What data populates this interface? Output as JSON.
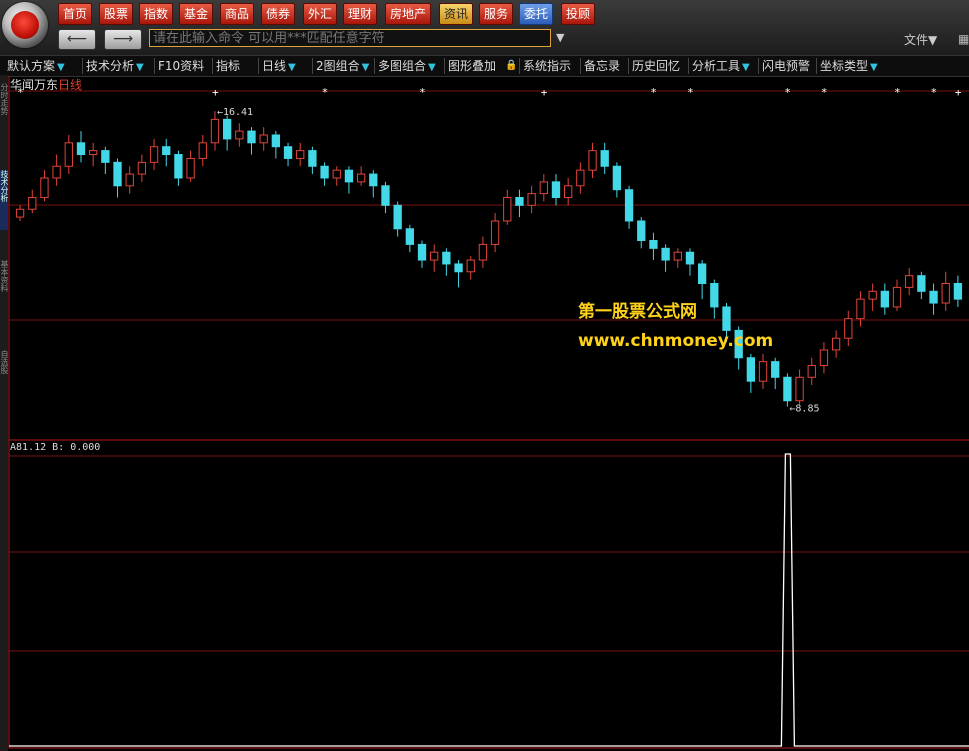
{
  "top_nav": {
    "items": [
      {
        "label": "首页"
      },
      {
        "label": "股票"
      },
      {
        "label": "指数"
      },
      {
        "label": "基金"
      },
      {
        "label": "商品"
      },
      {
        "label": "债券"
      },
      {
        "label": "外汇"
      },
      {
        "label": "理财"
      },
      {
        "label": "房地产"
      },
      {
        "label": "资讯"
      },
      {
        "label": "服务"
      },
      {
        "label": "委托"
      },
      {
        "label": "投顾"
      }
    ],
    "active": "委托",
    "highlight": "资讯"
  },
  "command": {
    "placeholder": "请在此输入命令    可以用***匹配任意字符",
    "back_icon": "back-arrow-icon",
    "forward_icon": "forward-arrow-icon"
  },
  "file_menu": {
    "label": "文件▼"
  },
  "toolbar": {
    "items": [
      {
        "label": "默认方案",
        "dropdown": true
      },
      {
        "label": "技术分析",
        "dropdown": true
      },
      {
        "label": "F10资料",
        "dropdown": false
      },
      {
        "label": "指标",
        "dropdown": false
      },
      {
        "label": "日线",
        "dropdown": true
      },
      {
        "label": "2图组合",
        "dropdown": true
      },
      {
        "label": "多图组合",
        "dropdown": true
      },
      {
        "label": "图形叠加",
        "dropdown": false
      },
      {
        "label": "系统指示",
        "dropdown": false
      },
      {
        "label": "备忘录",
        "dropdown": false
      },
      {
        "label": "历史回忆",
        "dropdown": false
      },
      {
        "label": "分析工具",
        "dropdown": true
      },
      {
        "label": "闪电预警",
        "dropdown": false
      },
      {
        "label": "坐标类型",
        "dropdown": true
      }
    ]
  },
  "left_tabs": [
    "分时走势",
    "技术分析",
    "基本资料",
    "自选股"
  ],
  "chart": {
    "stock_name": "华闻万东",
    "period": "日线",
    "high_label": "←16.41",
    "low_label": "←8.85",
    "sub_indicator": "A81.12  B: 0.000"
  },
  "watermark": {
    "line1": "第一股票公式网",
    "line2": "www.chnmoney.com"
  },
  "colors": {
    "up": "#e0453a",
    "down": "#43d8e8",
    "accent": "#ffd21a",
    "grid": "#7a1010"
  },
  "chart_data": {
    "type": "candlestick",
    "high": 16.41,
    "low": 8.85,
    "candles": [
      [
        13.7,
        13.9,
        13.6,
        14.0
      ],
      [
        13.9,
        14.2,
        13.8,
        14.4
      ],
      [
        14.2,
        14.7,
        14.1,
        14.9
      ],
      [
        14.7,
        15.0,
        14.5,
        15.3
      ],
      [
        15.0,
        15.6,
        14.8,
        15.8
      ],
      [
        15.6,
        15.3,
        15.1,
        15.9
      ],
      [
        15.3,
        15.4,
        15.0,
        15.6
      ],
      [
        15.4,
        15.1,
        14.8,
        15.5
      ],
      [
        15.1,
        14.5,
        14.2,
        15.2
      ],
      [
        14.5,
        14.8,
        14.3,
        15.0
      ],
      [
        14.8,
        15.1,
        14.6,
        15.3
      ],
      [
        15.1,
        15.5,
        14.9,
        15.7
      ],
      [
        15.5,
        15.3,
        15.0,
        15.7
      ],
      [
        15.3,
        14.7,
        14.5,
        15.4
      ],
      [
        14.7,
        15.2,
        14.6,
        15.4
      ],
      [
        15.2,
        15.6,
        15.0,
        15.8
      ],
      [
        15.6,
        16.2,
        15.4,
        16.41
      ],
      [
        16.2,
        15.7,
        15.4,
        16.3
      ],
      [
        15.7,
        15.9,
        15.5,
        16.1
      ],
      [
        15.9,
        15.6,
        15.3,
        16.0
      ],
      [
        15.6,
        15.8,
        15.4,
        16.0
      ],
      [
        15.8,
        15.5,
        15.2,
        15.9
      ],
      [
        15.5,
        15.2,
        15.0,
        15.6
      ],
      [
        15.2,
        15.4,
        15.0,
        15.6
      ],
      [
        15.4,
        15.0,
        14.8,
        15.5
      ],
      [
        15.0,
        14.7,
        14.5,
        15.1
      ],
      [
        14.7,
        14.9,
        14.5,
        15.0
      ],
      [
        14.9,
        14.6,
        14.3,
        15.0
      ],
      [
        14.6,
        14.8,
        14.5,
        15.0
      ],
      [
        14.8,
        14.5,
        14.2,
        14.9
      ],
      [
        14.5,
        14.0,
        13.8,
        14.6
      ],
      [
        14.0,
        13.4,
        13.2,
        14.1
      ],
      [
        13.4,
        13.0,
        12.8,
        13.5
      ],
      [
        13.0,
        12.6,
        12.4,
        13.1
      ],
      [
        12.6,
        12.8,
        12.3,
        13.0
      ],
      [
        12.8,
        12.5,
        12.2,
        12.9
      ],
      [
        12.5,
        12.3,
        11.9,
        12.6
      ],
      [
        12.3,
        12.6,
        12.1,
        12.7
      ],
      [
        12.6,
        13.0,
        12.4,
        13.2
      ],
      [
        13.0,
        13.6,
        12.8,
        13.8
      ],
      [
        13.6,
        14.2,
        13.5,
        14.4
      ],
      [
        14.2,
        14.0,
        13.7,
        14.4
      ],
      [
        14.0,
        14.3,
        13.8,
        14.5
      ],
      [
        14.3,
        14.6,
        14.1,
        14.8
      ],
      [
        14.6,
        14.2,
        14.0,
        14.8
      ],
      [
        14.2,
        14.5,
        14.0,
        14.7
      ],
      [
        14.5,
        14.9,
        14.3,
        15.1
      ],
      [
        14.9,
        15.4,
        14.7,
        15.6
      ],
      [
        15.4,
        15.0,
        14.8,
        15.6
      ],
      [
        15.0,
        14.4,
        14.2,
        15.1
      ],
      [
        14.4,
        13.6,
        13.4,
        14.5
      ],
      [
        13.6,
        13.1,
        12.9,
        13.7
      ],
      [
        13.1,
        12.9,
        12.6,
        13.3
      ],
      [
        12.9,
        12.6,
        12.3,
        13.0
      ],
      [
        12.6,
        12.8,
        12.4,
        12.9
      ],
      [
        12.8,
        12.5,
        12.2,
        12.9
      ],
      [
        12.5,
        12.0,
        11.6,
        12.6
      ],
      [
        12.0,
        11.4,
        11.1,
        12.1
      ],
      [
        11.4,
        10.8,
        10.5,
        11.5
      ],
      [
        10.8,
        10.1,
        9.8,
        10.9
      ],
      [
        10.1,
        9.5,
        9.2,
        10.2
      ],
      [
        9.5,
        10.0,
        9.3,
        10.2
      ],
      [
        10.0,
        9.6,
        9.3,
        10.1
      ],
      [
        9.6,
        9.0,
        8.85,
        9.7
      ],
      [
        9.0,
        9.6,
        8.9,
        9.8
      ],
      [
        9.6,
        9.9,
        9.4,
        10.1
      ],
      [
        9.9,
        10.3,
        9.7,
        10.5
      ],
      [
        10.3,
        10.6,
        10.1,
        10.8
      ],
      [
        10.6,
        11.1,
        10.4,
        11.3
      ],
      [
        11.1,
        11.6,
        10.9,
        11.8
      ],
      [
        11.6,
        11.8,
        11.3,
        12.0
      ],
      [
        11.8,
        11.4,
        11.2,
        12.0
      ],
      [
        11.4,
        11.9,
        11.3,
        12.1
      ],
      [
        11.9,
        12.2,
        11.7,
        12.4
      ],
      [
        12.2,
        11.8,
        11.6,
        12.3
      ],
      [
        11.8,
        11.5,
        11.2,
        12.0
      ],
      [
        11.5,
        12.0,
        11.3,
        12.3
      ],
      [
        12.0,
        11.6,
        11.4,
        12.2
      ]
    ],
    "signal_markers": [
      {
        "index": 0,
        "symbol": "*"
      },
      {
        "index": 16,
        "symbol": "+"
      },
      {
        "index": 25,
        "symbol": "*"
      },
      {
        "index": 33,
        "symbol": "*"
      },
      {
        "index": 43,
        "symbol": "+"
      },
      {
        "index": 52,
        "symbol": "*"
      },
      {
        "index": 55,
        "symbol": "*"
      },
      {
        "index": 63,
        "symbol": "*"
      },
      {
        "index": 66,
        "symbol": "*"
      },
      {
        "index": 72,
        "symbol": "*"
      },
      {
        "index": 75,
        "symbol": "*"
      },
      {
        "index": 77,
        "symbol": "+"
      }
    ],
    "indicator": {
      "name": "A",
      "value_label": "A81.12",
      "b_label": "B: 0.000",
      "spike_index": 63,
      "spike_value": 1,
      "baseline": 0
    }
  }
}
